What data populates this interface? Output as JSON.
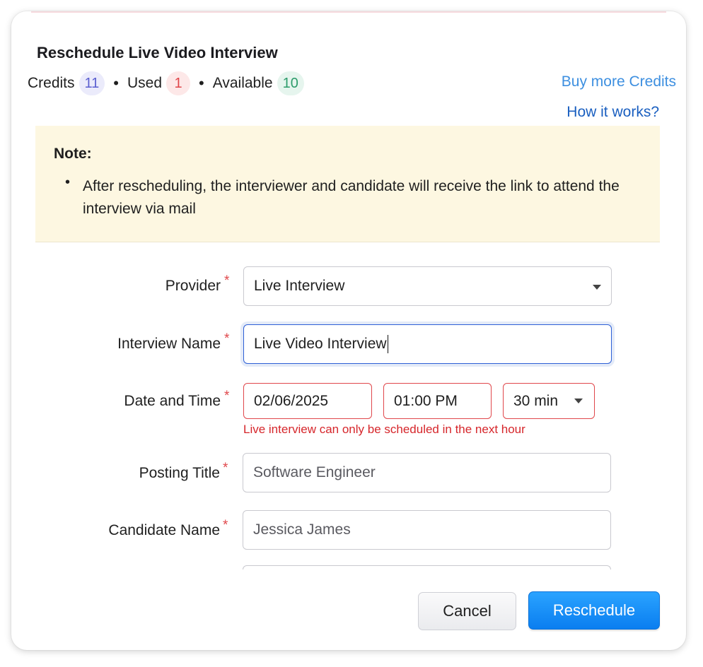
{
  "dialog": {
    "title": "Reschedule Live Video Interview"
  },
  "credits": {
    "credits_label": "Credits",
    "credits_value": "11",
    "used_label": "Used",
    "used_value": "1",
    "available_label": "Available",
    "available_value": "10",
    "separator": "•",
    "buy_link": "Buy more Credits",
    "how_link": "How it works?"
  },
  "note": {
    "title": "Note:",
    "bullet": "•",
    "text": "After rescheduling, the interviewer and candidate will receive the link to attend the interview via mail"
  },
  "form": {
    "required_mark": "*",
    "provider": {
      "label": "Provider",
      "value": "Live Interview"
    },
    "interview_name": {
      "label": "Interview Name",
      "value": "Live Video Interview"
    },
    "date_time": {
      "label": "Date and Time",
      "date": "02/06/2025",
      "time": "01:00 PM",
      "duration": "30 min",
      "error": "Live interview can only be scheduled in the next hour"
    },
    "posting_title": {
      "label": "Posting Title",
      "value": "Software Engineer"
    },
    "candidate_name": {
      "label": "Candidate Name",
      "value": "Jessica James"
    }
  },
  "actions": {
    "cancel": "Cancel",
    "reschedule": "Reschedule"
  },
  "colors": {
    "link": "#3d8fe0",
    "primary": "#0a7ef0",
    "error": "#e0474b",
    "note_bg": "#fdf7e1"
  }
}
